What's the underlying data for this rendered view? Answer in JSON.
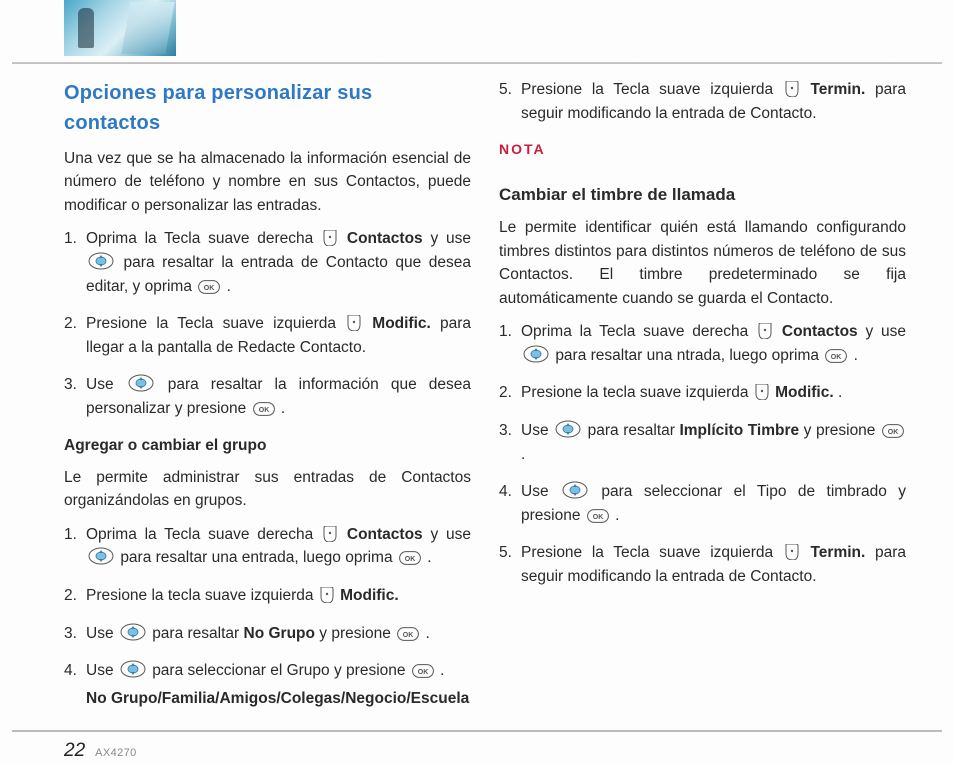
{
  "header": {
    "image_desc": "cityscape-photo"
  },
  "left": {
    "title": "Opciones para personalizar sus contactos",
    "intro": "Una vez que se ha almacenado la información esencial de número de teléfono y nombre en sus Contactos, puede modificar o personalizar las entradas.",
    "steps": {
      "s1_pre": "Oprima la Tecla suave derecha ",
      "s1_bold": "Contactos",
      "s1_mid": " y use ",
      "s1_after": " para resaltar la entrada de Contacto que desea editar, y oprima ",
      "s1_end": ".",
      "s2_pre": "Presione la Tecla suave izquierda ",
      "s2_bold": "Modific.",
      "s2_end": " para llegar a la pantalla de Redacte Contacto.",
      "s3_pre": "Use ",
      "s3_mid": " para resaltar la información que desea personalizar y presione ",
      "s3_end": "."
    },
    "sub1": {
      "head": "Agregar o cambiar el grupo",
      "body": "Le permite administrar sus entradas de Contactos organizándolas en grupos.",
      "g1_pre": "Oprima la Tecla suave derecha ",
      "g1_bold": "Contactos",
      "g1_mid": " y use ",
      "g1_after": " para resaltar una entrada, luego oprima ",
      "g1_end": ".",
      "g2_pre": "Presione la tecla suave izquierda ",
      "g2_bold": "Modific.",
      "g3_pre": "Use ",
      "g3_mid": " para resaltar ",
      "g3_bold": "No Grupo",
      "g3_after": " y presione ",
      "g3_end": ".",
      "g4_pre": "Use ",
      "g4_mid": " para seleccionar el Grupo y presione ",
      "g4_end": ".",
      "groups": "No Grupo/Familia/Amigos/Colegas/Negocio/Escuela"
    }
  },
  "right": {
    "r5_pre": "Presione la Tecla suave izquierda ",
    "r5_bold": "Termin.",
    "r5_end": " para seguir modificando la entrada de Contacto.",
    "nota": "NOTA",
    "sub2": {
      "head": "Cambiar el timbre de llamada",
      "body": "Le permite identificar quién está llamando configurando timbres distintos para distintos números de teléfono de sus Contactos. El timbre predeterminado se fija automáticamente cuando se guarda el Contacto.",
      "t1_pre": "Oprima la Tecla suave derecha ",
      "t1_bold": "Contactos",
      "t1_mid": " y use ",
      "t1_after": " para resaltar una ntrada, luego oprima ",
      "t1_end": ".",
      "t2_pre": "Presione la tecla suave izquierda ",
      "t2_bold": "Modific.",
      "t2_end": ".",
      "t3_pre": "Use ",
      "t3_mid": " para resaltar ",
      "t3_bold": "Implícito Timbre",
      "t3_after": " y presione ",
      "t3_end": ".",
      "t4_pre": "Use ",
      "t4_mid": " para seleccionar el Tipo de timbrado y presione ",
      "t4_end": ".",
      "t5_pre": "Presione la Tecla suave izquierda ",
      "t5_bold": "Termin.",
      "t5_end": " para seguir modificando la entrada de Contacto."
    }
  },
  "footer": {
    "page": "22",
    "model": "AX4270"
  }
}
